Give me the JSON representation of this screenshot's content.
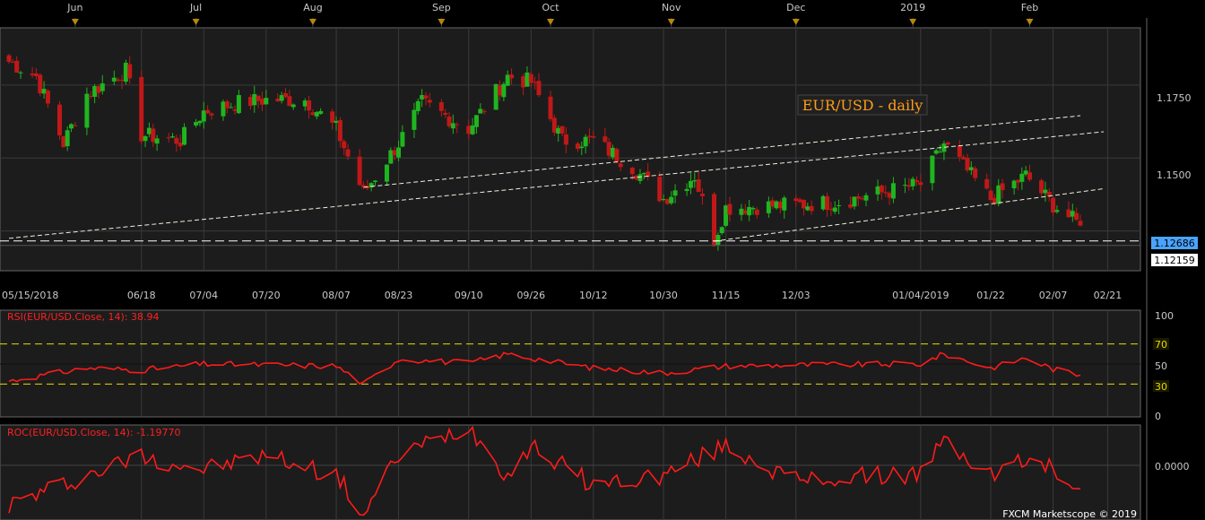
{
  "colors": {
    "background": "#000000",
    "panel": "#1c1c1c",
    "grid": "#3a3a3a",
    "axis_text": "#c8c8c8",
    "up": "#1fb51f",
    "down": "#c01818",
    "trend_line": "#f0f0e0",
    "support_line": "#ffffff",
    "rsi_line": "#ff1a1a",
    "roc_line": "#ff1a1a",
    "rsi_level": "#e8d800",
    "month_marker": "#b8860b",
    "title_text": "#ff9c1a",
    "title_bg": "#202020",
    "last_price_bg": "#4aa3ff"
  },
  "header": {
    "months": [
      "Jun",
      "Jul",
      "Aug",
      "Sep",
      "Oct",
      "Nov",
      "Dec",
      "2019",
      "Feb"
    ]
  },
  "main": {
    "title": "EUR/USD - daily",
    "price_labels": [
      "1.1750",
      "1.1500"
    ],
    "last_price": "1.12686",
    "support_price": "1.12159",
    "date_labels": [
      "05/15/2018",
      "06/18",
      "07/04",
      "07/20",
      "08/07",
      "08/23",
      "09/10",
      "09/26",
      "10/12",
      "10/30",
      "11/15",
      "12/03",
      "01/04/2019",
      "01/22",
      "02/07",
      "02/21"
    ]
  },
  "rsi": {
    "label": "RSI(EUR/USD.Close, 14): 38.94",
    "levels": [
      "100",
      "70",
      "50",
      "30",
      "0"
    ]
  },
  "roc": {
    "label": "ROC(EUR/USD.Close, 14): -1.19770",
    "zero_label": "0.0000"
  },
  "footer": {
    "copyright": "FXCM Marketscope © 2019"
  },
  "chart_data": [
    {
      "type": "candlestick",
      "title": "EUR/USD - daily",
      "ylim": [
        1.112,
        1.194
      ],
      "note_x": "trading days from 05/15/2018 to 02/14/2019",
      "close_anchors": [
        [
          "05/15/2018",
          1.183
        ],
        [
          "05/22/2018",
          1.178
        ],
        [
          "05/29/2018",
          1.155
        ],
        [
          "06/04/2018",
          1.172
        ],
        [
          "06/14/2018",
          1.18
        ],
        [
          "06/18/2018",
          1.158
        ],
        [
          "06/28/2018",
          1.156
        ],
        [
          "07/04/2018",
          1.166
        ],
        [
          "07/13/2018",
          1.169
        ],
        [
          "07/20/2018",
          1.17
        ],
        [
          "07/30/2018",
          1.17
        ],
        [
          "08/07/2018",
          1.16
        ],
        [
          "08/14/2018",
          1.138
        ],
        [
          "08/23/2018",
          1.155
        ],
        [
          "08/29/2018",
          1.169
        ],
        [
          "09/10/2018",
          1.16
        ],
        [
          "09/20/2018",
          1.178
        ],
        [
          "09/26/2018",
          1.176
        ],
        [
          "10/04/2018",
          1.156
        ],
        [
          "10/12/2018",
          1.156
        ],
        [
          "10/22/2018",
          1.147
        ],
        [
          "10/30/2018",
          1.136
        ],
        [
          "11/07/2018",
          1.144
        ],
        [
          "11/12/2018",
          1.122
        ],
        [
          "11/15/2018",
          1.133
        ],
        [
          "12/03/2018",
          1.134
        ],
        [
          "12/14/2018",
          1.135
        ],
        [
          "01/04/2019",
          1.141
        ],
        [
          "01/10/2019",
          1.155
        ],
        [
          "01/22/2019",
          1.136
        ],
        [
          "01/31/2019",
          1.144
        ],
        [
          "02/07/2019",
          1.134
        ],
        [
          "02/14/2019",
          1.1269
        ]
      ],
      "last_price": 1.12686,
      "horizontal_support": 1.12159,
      "lower_trendline": [
        [
          "05/15/2018",
          1.1225
        ],
        [
          "02/20/2019",
          1.159
        ]
      ],
      "upper_trendline": [
        [
          "08/14/2018",
          1.14
        ],
        [
          "02/14/2019",
          1.1645
        ]
      ],
      "lower_trendline_2": [
        [
          "11/12/2018",
          1.1215
        ],
        [
          "02/20/2019",
          1.1395
        ]
      ]
    },
    {
      "type": "line",
      "title": "RSI(EUR/USD.Close, 14): 38.94",
      "ylim": [
        0,
        100
      ],
      "levels": [
        70,
        50,
        30
      ],
      "last_value": 38.94,
      "anchors": [
        [
          "05/15/2018",
          33
        ],
        [
          "06/04/2018",
          46
        ],
        [
          "06/18/2018",
          44
        ],
        [
          "07/04/2018",
          50
        ],
        [
          "07/20/2018",
          49
        ],
        [
          "08/07/2018",
          48
        ],
        [
          "08/14/2018",
          30
        ],
        [
          "08/23/2018",
          55
        ],
        [
          "09/10/2018",
          51
        ],
        [
          "09/20/2018",
          60
        ],
        [
          "09/26/2018",
          56
        ],
        [
          "10/12/2018",
          46
        ],
        [
          "10/30/2018",
          41
        ],
        [
          "11/15/2018",
          48
        ],
        [
          "12/03/2018",
          49
        ],
        [
          "01/04/2019",
          50
        ],
        [
          "01/10/2019",
          60
        ],
        [
          "01/22/2019",
          46
        ],
        [
          "01/31/2019",
          56
        ],
        [
          "02/07/2019",
          45
        ],
        [
          "02/14/2019",
          38.94
        ]
      ]
    },
    {
      "type": "line",
      "title": "ROC(EUR/USD.Close, 14): -1.19770",
      "zero_line": 0,
      "last_value": -1.1977,
      "anchors": [
        [
          "05/15/2018",
          -2.0
        ],
        [
          "06/04/2018",
          -0.5
        ],
        [
          "06/18/2018",
          0.5
        ],
        [
          "07/04/2018",
          -0.2
        ],
        [
          "07/20/2018",
          0.5
        ],
        [
          "08/07/2018",
          -0.5
        ],
        [
          "08/14/2018",
          -2.5
        ],
        [
          "08/23/2018",
          0.5
        ],
        [
          "09/10/2018",
          2.0
        ],
        [
          "09/20/2018",
          -0.5
        ],
        [
          "09/26/2018",
          1.0
        ],
        [
          "10/12/2018",
          -1.0
        ],
        [
          "10/30/2018",
          -0.5
        ],
        [
          "11/15/2018",
          1.0
        ],
        [
          "12/03/2018",
          -0.8
        ],
        [
          "01/04/2019",
          -0.4
        ],
        [
          "01/10/2019",
          1.2
        ],
        [
          "01/22/2019",
          -0.5
        ],
        [
          "01/31/2019",
          0.3
        ],
        [
          "02/07/2019",
          -0.2
        ],
        [
          "02/14/2019",
          -1.1977
        ]
      ]
    }
  ]
}
